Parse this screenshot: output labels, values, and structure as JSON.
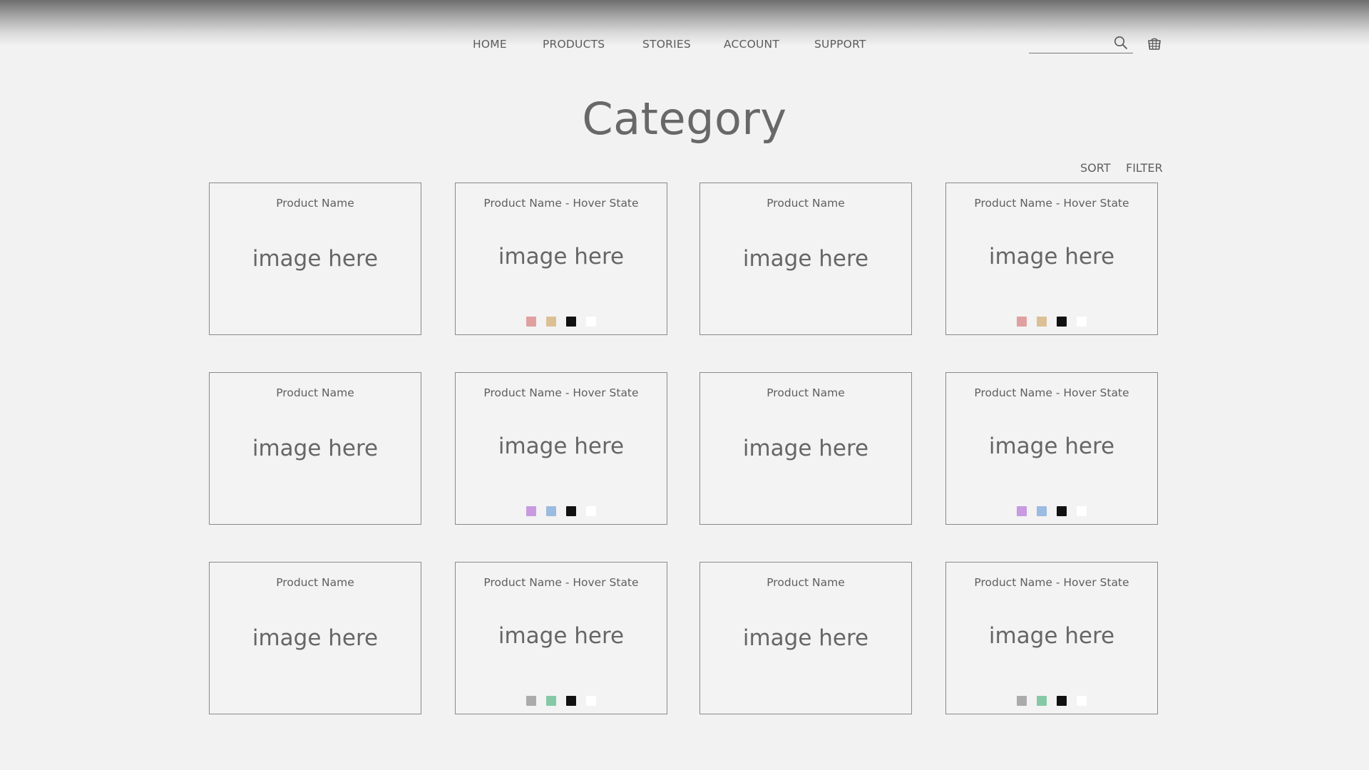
{
  "nav": {
    "items": [
      {
        "label": "HOME"
      },
      {
        "label": "PRODUCTS"
      },
      {
        "label": "STORIES"
      },
      {
        "label": "ACCOUNT"
      },
      {
        "label": "SUPPORT"
      }
    ]
  },
  "search": {
    "value": "",
    "placeholder": "",
    "icon": "search-icon"
  },
  "cart": {
    "icon": "cart-icon"
  },
  "page": {
    "title": "Category",
    "sort_label": "SORT",
    "filter_label": "FILTER"
  },
  "products": [
    {
      "name": "Product Name",
      "image_text": "image here",
      "swatches": []
    },
    {
      "name": "Product Name - Hover State",
      "image_text": "image here",
      "swatches": [
        "#e0a0a0",
        "#dcc095",
        "#111111",
        "#ffffff"
      ]
    },
    {
      "name": "Product Name",
      "image_text": "image here",
      "swatches": []
    },
    {
      "name": "Product Name - Hover State",
      "image_text": "image here",
      "swatches": [
        "#e0a0a0",
        "#dcc095",
        "#111111",
        "#ffffff"
      ]
    },
    {
      "name": "Product Name",
      "image_text": "image here",
      "swatches": []
    },
    {
      "name": "Product Name - Hover State",
      "image_text": "image here",
      "swatches": [
        "#c89ae0",
        "#9bbbe0",
        "#111111",
        "#ffffff"
      ]
    },
    {
      "name": "Product Name",
      "image_text": "image here",
      "swatches": []
    },
    {
      "name": "Product Name - Hover State",
      "image_text": "image here",
      "swatches": [
        "#c89ae0",
        "#9bbbe0",
        "#111111",
        "#ffffff"
      ]
    },
    {
      "name": "Product Name",
      "image_text": "image here",
      "swatches": []
    },
    {
      "name": "Product Name - Hover State",
      "image_text": "image here",
      "swatches": [
        "#ababab",
        "#86c9a6",
        "#111111",
        "#ffffff"
      ]
    },
    {
      "name": "Product Name",
      "image_text": "image here",
      "swatches": []
    },
    {
      "name": "Product Name - Hover State",
      "image_text": "image here",
      "swatches": [
        "#ababab",
        "#86c9a6",
        "#111111",
        "#ffffff"
      ]
    }
  ]
}
